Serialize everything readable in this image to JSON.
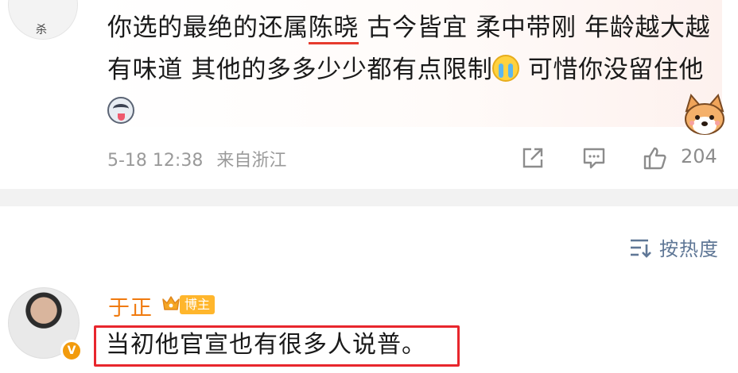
{
  "comment1": {
    "avatar_glyph": "杀",
    "text_part1": "你选的最绝的还属",
    "text_highlight": "陈晓",
    "text_part2": " 古今皆宜 柔中带刚 年龄越大越有味道 其他的多多少少都有点限制",
    "text_part3": " 可惜你没留住他",
    "timestamp": "5-18 12:38",
    "source": "来自浙江",
    "like_count": "204"
  },
  "sort": {
    "label": "按热度"
  },
  "comment2": {
    "username": "于正",
    "role_badge": "博主",
    "avatar_badge": "V",
    "text": "当初他官宣也有很多人说普。"
  },
  "colors": {
    "highlight_underline": "#e63b2e",
    "username": "#f07a0e",
    "badge": "#ffb62c",
    "sort_label": "#5f7796",
    "reply_box_border": "#e8262d"
  },
  "icons": [
    "cry-emoji",
    "husky-emoji",
    "corgi-sticker",
    "share-icon",
    "comment-icon",
    "like-icon",
    "sort-icon",
    "crown-icon",
    "verified-icon"
  ]
}
